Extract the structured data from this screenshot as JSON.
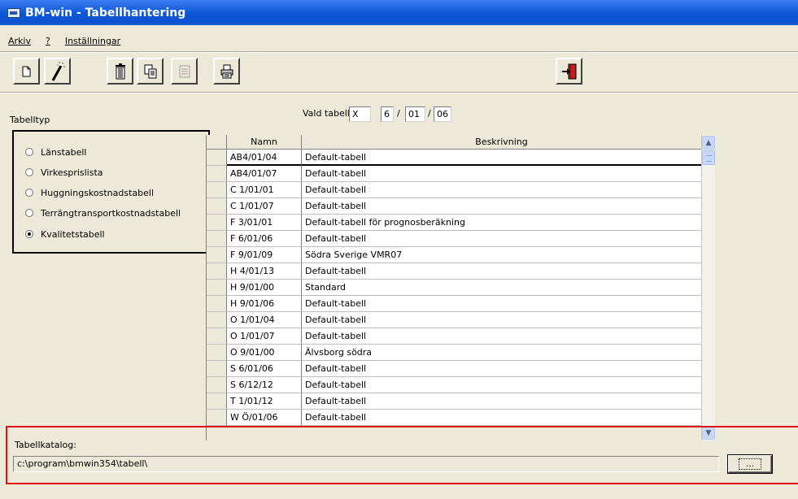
{
  "window": {
    "title": "BM-win - Tabellhantering"
  },
  "menu": [
    {
      "label": "Arkiv"
    },
    {
      "label": "?"
    },
    {
      "label": "Inställningar"
    }
  ],
  "toolbar": {
    "buttons": [
      {
        "icon": "new-document-icon"
      },
      {
        "icon": "magic-wand-icon"
      },
      {
        "icon": "trash-icon"
      },
      {
        "icon": "copy-icon"
      },
      {
        "icon": "properties-icon",
        "disabled": true
      },
      {
        "icon": "print-icon"
      },
      {
        "icon": "exit-door-icon"
      }
    ]
  },
  "table_type": {
    "label": "Tabelltyp",
    "options": [
      {
        "label": "Länstabell",
        "checked": false
      },
      {
        "label": "Virkesprislista",
        "checked": false
      },
      {
        "label": "Huggningskostnadstabell",
        "checked": false
      },
      {
        "label": "Terrängtransportkostnadstabell",
        "checked": false
      },
      {
        "label": "Kvalitetstabell",
        "checked": true
      }
    ]
  },
  "selected_table": {
    "label": "Vald tabell:",
    "parts": [
      "X",
      "6",
      "01",
      "06"
    ],
    "separator": "/"
  },
  "grid": {
    "columns": [
      "Namn",
      "Beskrivning"
    ],
    "rows": [
      [
        "AB4/01/04",
        "Default-tabell"
      ],
      [
        "AB4/01/07",
        "Default-tabell"
      ],
      [
        "C 1/01/01",
        "Default-tabell"
      ],
      [
        "C 1/01/07",
        "Default-tabell"
      ],
      [
        "F 3/01/01",
        "Default-tabell för prognosberäkning"
      ],
      [
        "F 6/01/06",
        "Default-tabell"
      ],
      [
        "F 9/01/09",
        "Södra Sverige VMR07"
      ],
      [
        "H 4/01/13",
        "Default-tabell"
      ],
      [
        "H 9/01/00",
        "Standard"
      ],
      [
        "H 9/01/06",
        "Default-tabell"
      ],
      [
        "O 1/01/04",
        "Default-tabell"
      ],
      [
        "O 1/01/07",
        "Default-tabell"
      ],
      [
        "O 9/01/00",
        "Älvsborg södra"
      ],
      [
        "S 6/01/06",
        "Default-tabell"
      ],
      [
        "S 6/12/12",
        "Default-tabell"
      ],
      [
        "T 1/01/12",
        "Default-tabell"
      ],
      [
        "W Ö/01/06",
        "Default-tabell"
      ]
    ],
    "current_row": 0
  },
  "catalog": {
    "label": "Tabellkatalog:",
    "path": "c:\\program\\bmwin354\\tabell\\",
    "browse_label": "..."
  },
  "colors": {
    "titlebar": "#0a56d8",
    "window_bg": "#ece9d8",
    "highlight": "#e01414"
  }
}
